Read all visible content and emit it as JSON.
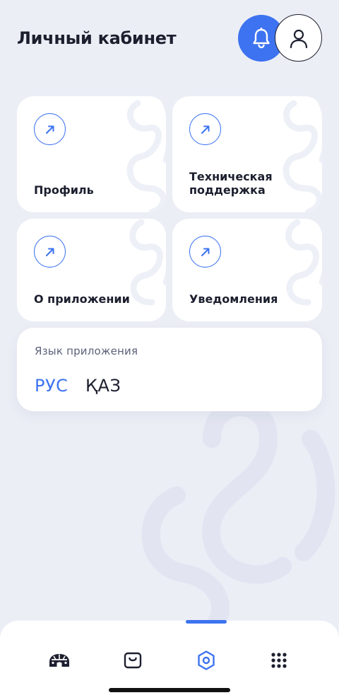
{
  "header": {
    "title": "Личный кабинет",
    "notifications_icon": "bell-icon",
    "profile_icon": "user-icon"
  },
  "cards": [
    {
      "label": "Профиль",
      "icon": "arrow-up-right-icon"
    },
    {
      "label": "Техническая поддержка",
      "icon": "arrow-up-right-icon"
    },
    {
      "label": "О приложении",
      "icon": "arrow-up-right-icon"
    },
    {
      "label": "Уведомления",
      "icon": "arrow-up-right-icon"
    }
  ],
  "language": {
    "title": "Язык приложения",
    "options": [
      "РУС",
      "ҚАЗ"
    ],
    "selected": "РУС"
  },
  "bottom_nav": {
    "items": [
      {
        "icon": "yurt-icon"
      },
      {
        "icon": "bag-icon"
      },
      {
        "icon": "settings-hex-icon",
        "active": true
      },
      {
        "icon": "grid-icon"
      }
    ]
  },
  "colors": {
    "accent": "#3d73f0",
    "background": "#eceef6",
    "card": "#ffffff",
    "text": "#1c1f2e"
  }
}
